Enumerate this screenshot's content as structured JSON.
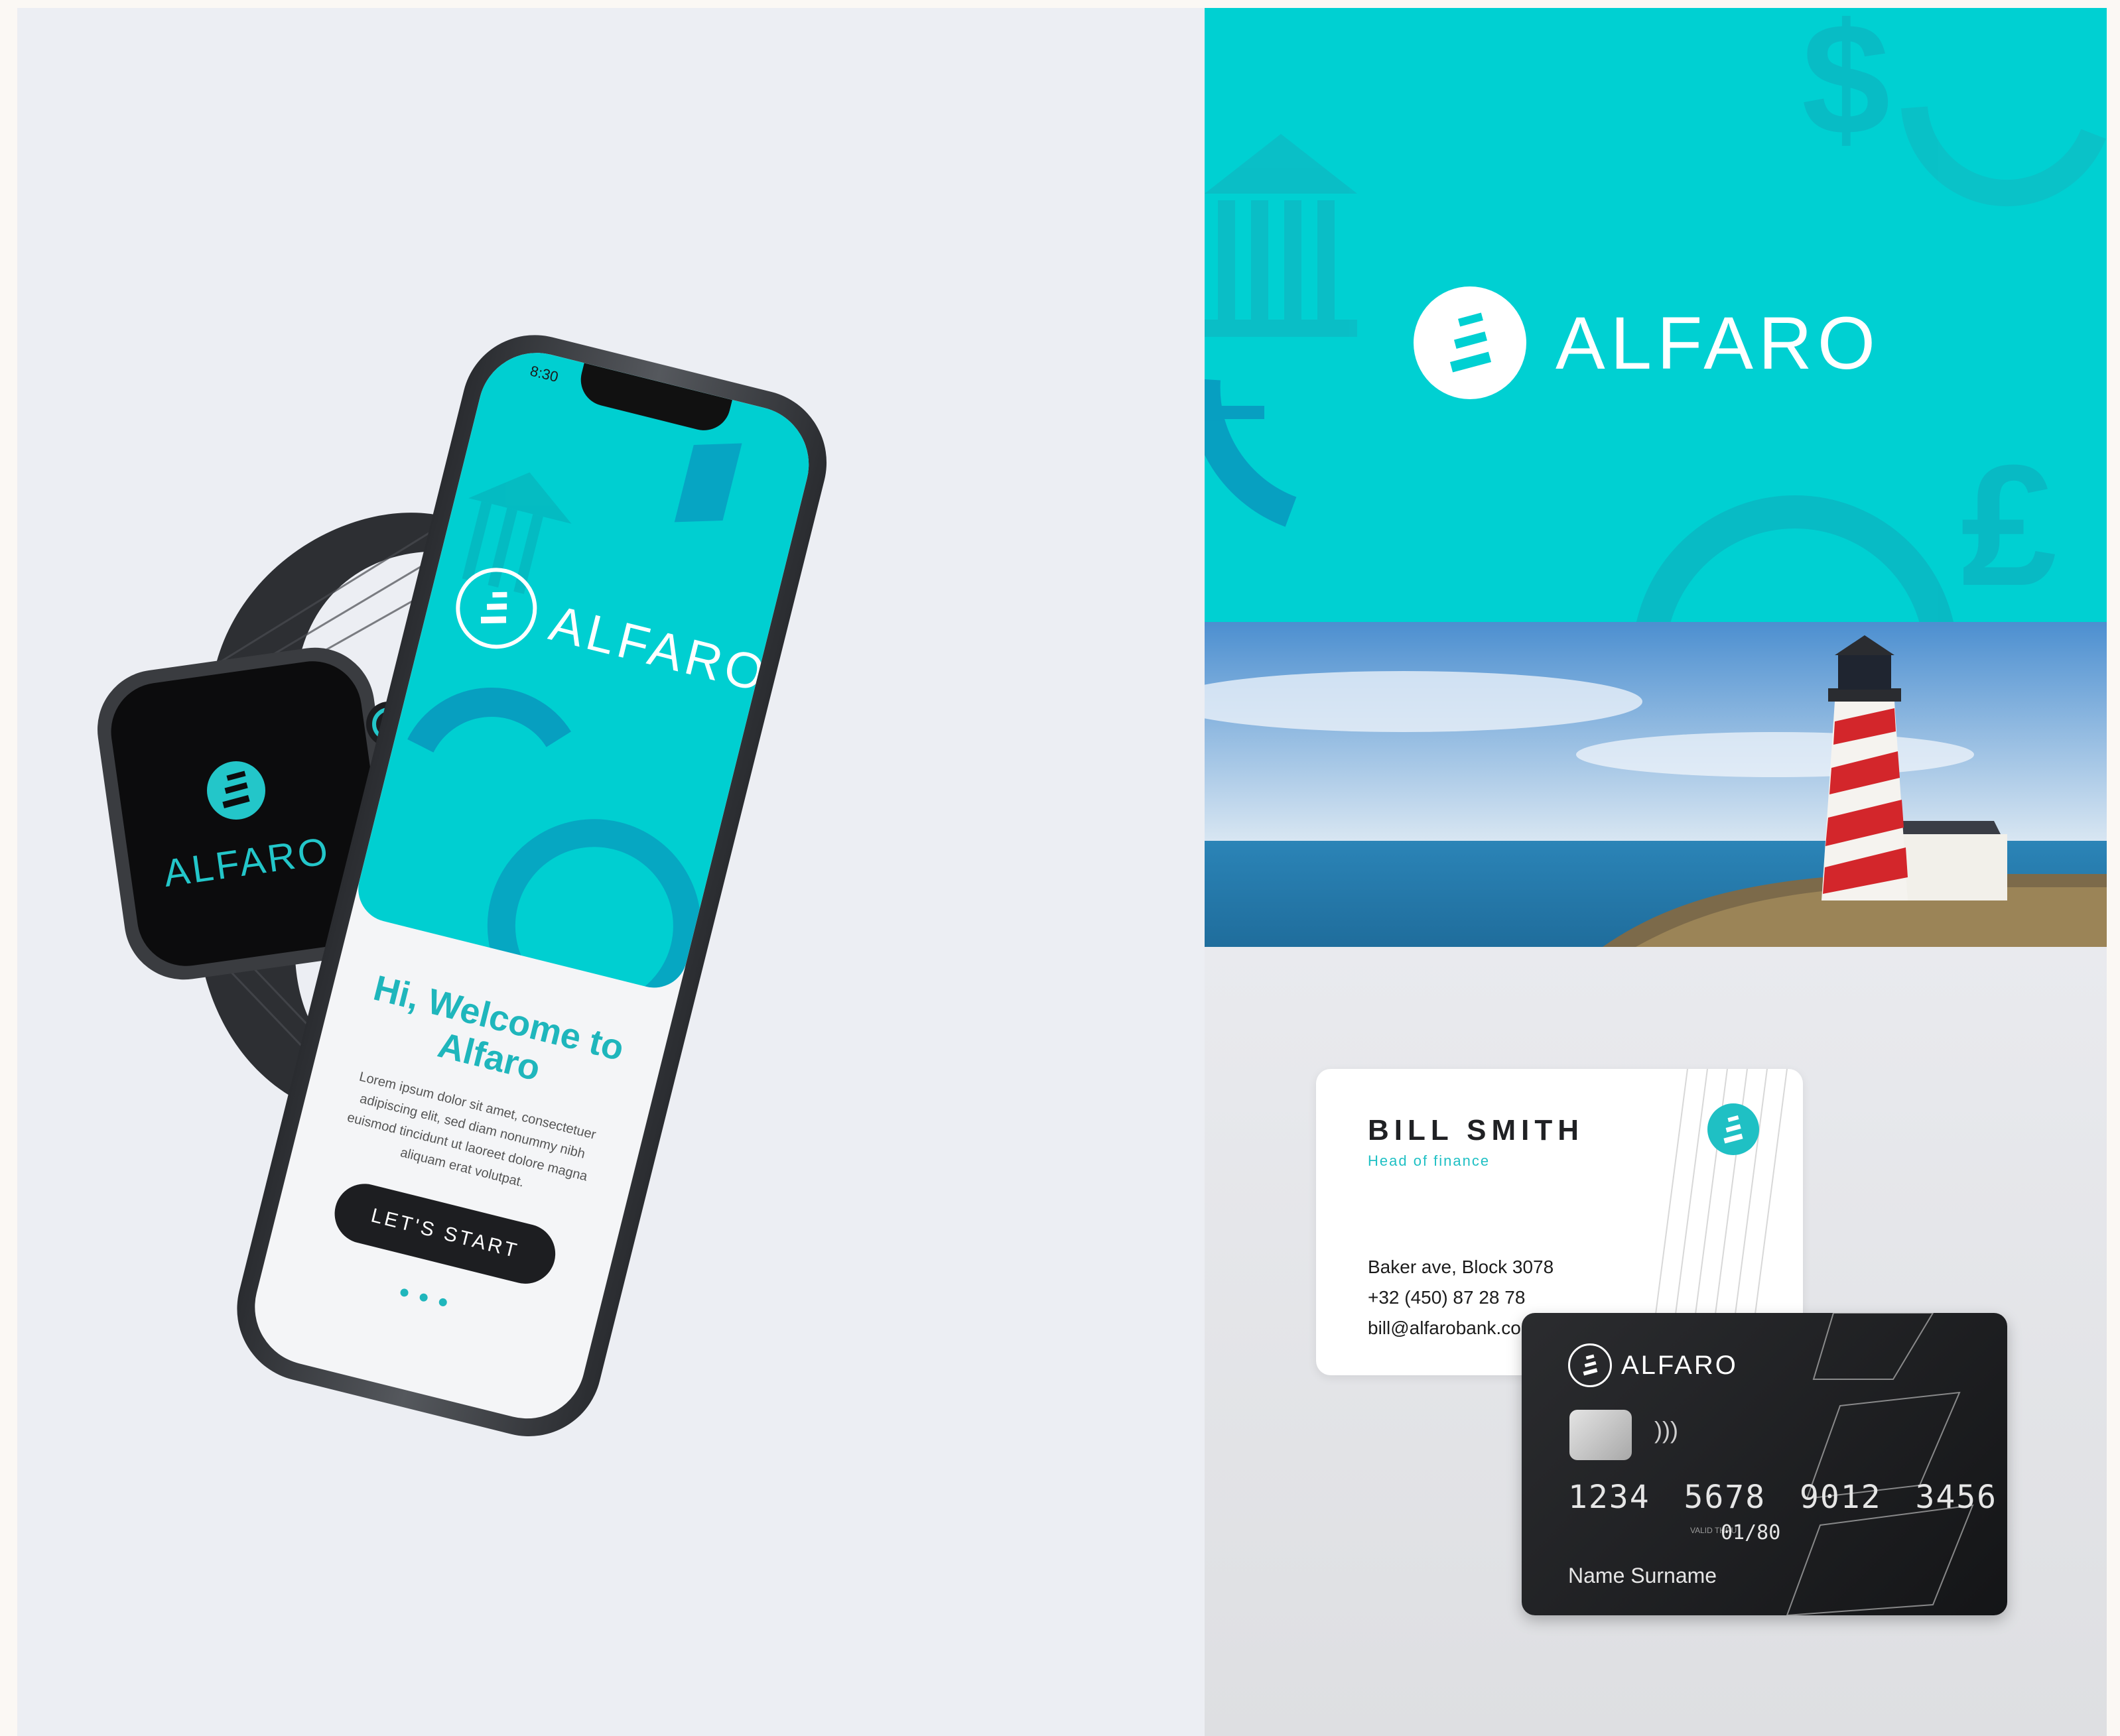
{
  "brand": {
    "name": "ALFARO",
    "teal": "#00d0d2",
    "dark": "#1d1e21"
  },
  "watch": {
    "brand": "ALFARO"
  },
  "phone": {
    "time": "8:30",
    "brand": "ALFARO",
    "welcome_line1": "Hi, Welcome to",
    "welcome_line2": "Alfaro",
    "lorem": "Lorem ipsum dolor sit amet, consectetuer adipiscing elit, sed diam nonummy nibh euismod tincidunt ut laoreet dolore magna aliquam erat volutpat.",
    "start_button": "LET'S START",
    "page_dots": 3
  },
  "banner": {
    "brand": "ALFARO",
    "icons": [
      "dollar-icon",
      "bank-icon",
      "euro-icon",
      "pound-icon"
    ]
  },
  "business_card": {
    "name": "BILL SMITH",
    "title": "Head of finance",
    "address": "Baker ave, Block 3078",
    "phone": "+32 (450) 87 28 78",
    "email": "bill@alfarobank.com"
  },
  "credit_card": {
    "brand": "ALFARO",
    "number": "1234 5678 9012 3456",
    "valid_label": "VALID THRU",
    "expiry": "01/80",
    "holder": "Name Surname"
  }
}
